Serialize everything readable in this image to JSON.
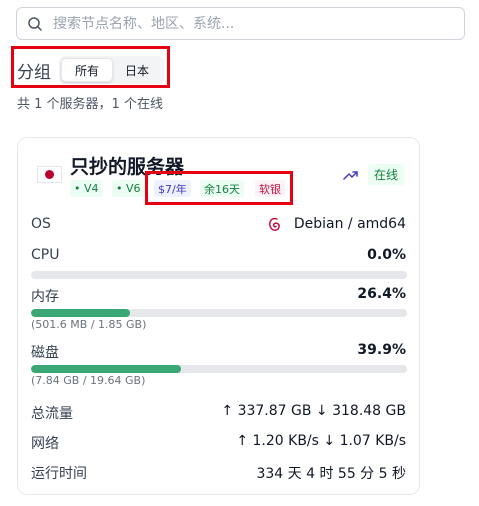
{
  "search": {
    "placeholder": "搜索节点名称、地区、系统..."
  },
  "group": {
    "label": "分组",
    "options": [
      "所有",
      "日本"
    ],
    "selected": "所有"
  },
  "summary": "共 1 个服务器，1 个在线",
  "server": {
    "name": "只抄的服务器",
    "flag_country": "Japan",
    "tags": {
      "v4": "• V4",
      "v6": "• V6",
      "price": "$7/年",
      "remaining": "余16天",
      "label": "软银"
    },
    "status": "在线",
    "os": {
      "label": "OS",
      "value": "Debian / amd64",
      "icon": "debian-icon"
    },
    "cpu": {
      "label": "CPU",
      "value": "0.0%",
      "fraction": 0.0
    },
    "memory": {
      "label": "内存",
      "value": "26.4%",
      "fraction": 0.264,
      "detail": "(501.6 MB / 1.85 GB)"
    },
    "disk": {
      "label": "磁盘",
      "value": "39.9%",
      "fraction": 0.399,
      "detail": "(7.84 GB / 19.64 GB)"
    },
    "traffic": {
      "label": "总流量",
      "value": "↑ 337.87 GB ↓ 318.48 GB"
    },
    "network": {
      "label": "网络",
      "value": "↑ 1.20 KB/s ↓ 1.07 KB/s"
    },
    "uptime": {
      "label": "运行时间",
      "value": "334 天 4 时 55 分 5 秒"
    }
  },
  "colors": {
    "bar_fill": "#3aa775",
    "highlight_box": "#e60012",
    "online_text": "#15803d"
  }
}
